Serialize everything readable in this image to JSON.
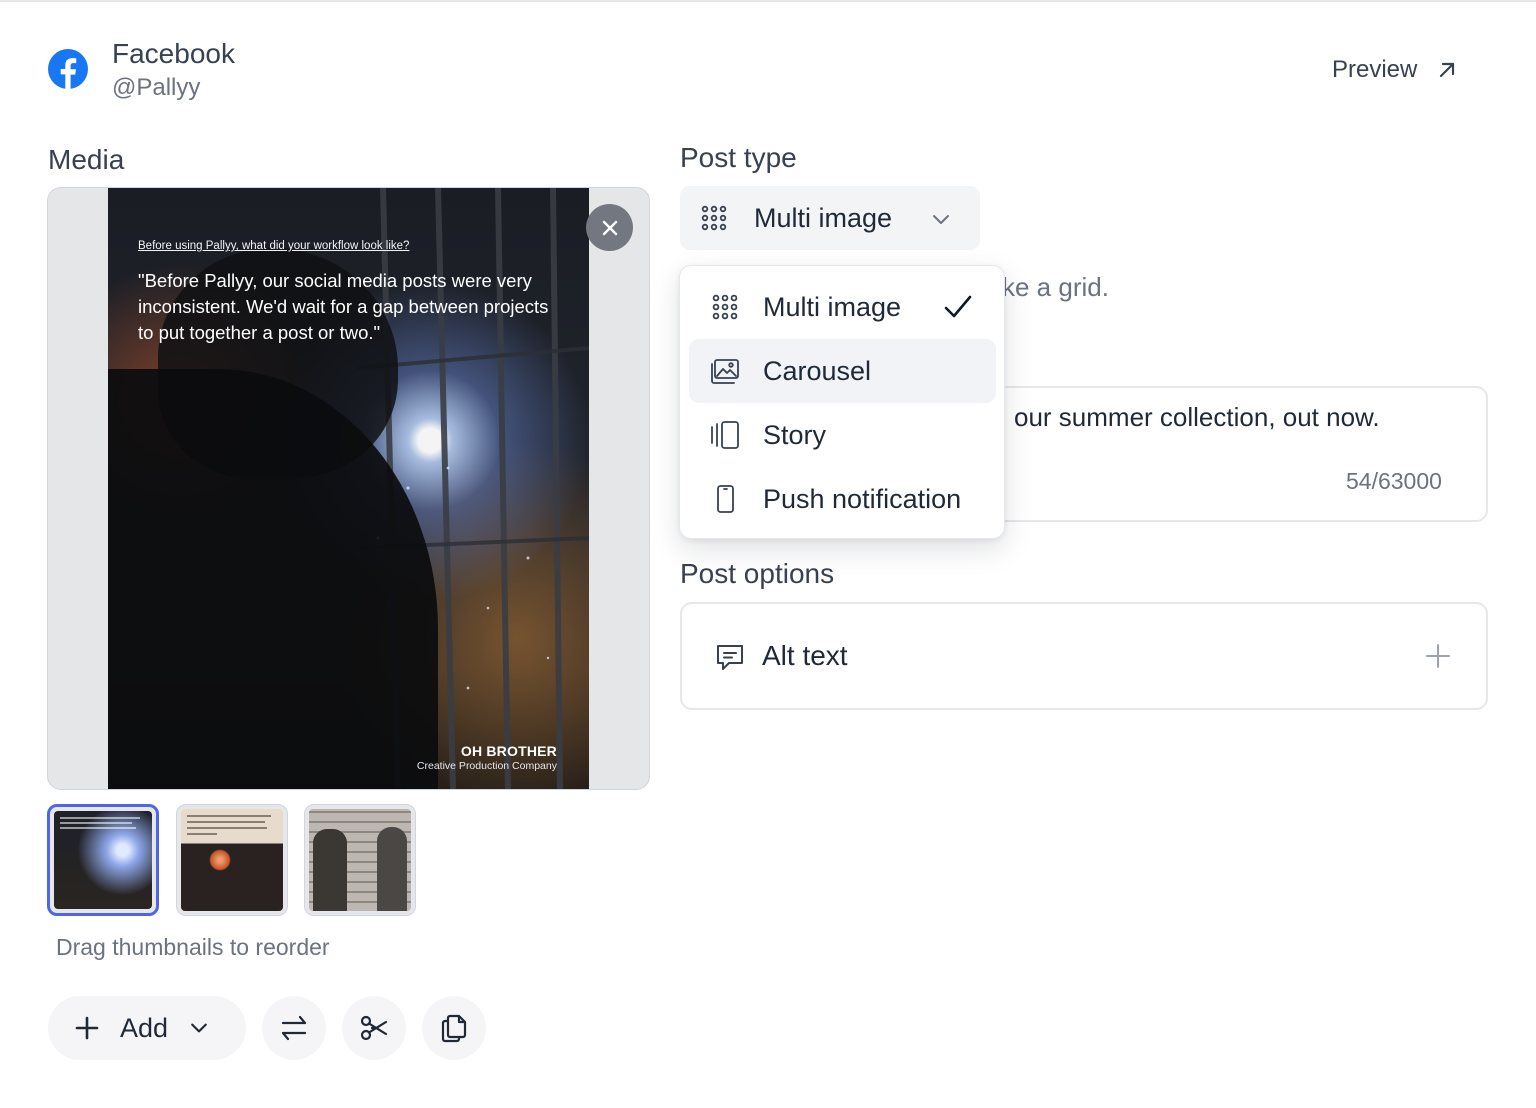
{
  "account": {
    "network": "Facebook",
    "handle": "@Pallyy",
    "brand_color": "#1877f2",
    "icon": "facebook-logo-icon"
  },
  "header": {
    "preview_label": "Preview",
    "preview_icon": "arrow-up-right-icon"
  },
  "media": {
    "label": "Media",
    "main_image": {
      "question": "Before using Pallyy, what did your workflow look like?",
      "quote": "\"Before Pallyy, our social media posts were very inconsistent. We'd wait for a gap between projects to put together a post or two.\"",
      "brand_name": "OH BROTHER",
      "brand_tagline": "Creative Production Company"
    },
    "thumbnails": [
      {
        "name": "thumbnail-1",
        "selected": true
      },
      {
        "name": "thumbnail-2",
        "selected": false
      },
      {
        "name": "thumbnail-3",
        "selected": false
      }
    ],
    "drag_hint": "Drag thumbnails to reorder",
    "selection_color": "#4f67e6"
  },
  "toolbar": {
    "add_label": "Add",
    "buttons": [
      "swap-icon",
      "scissors-icon",
      "copy-icon"
    ]
  },
  "post_type": {
    "label": "Post type",
    "selected": "Multi image",
    "hint_visible": "ke a grid.",
    "options": [
      {
        "label": "Multi image",
        "icon": "grid-icon",
        "checked": true
      },
      {
        "label": "Carousel",
        "icon": "images-icon",
        "checked": false,
        "hovered": true
      },
      {
        "label": "Story",
        "icon": "story-icon",
        "checked": false
      },
      {
        "label": "Push notification",
        "icon": "phone-icon",
        "checked": false
      }
    ]
  },
  "caption": {
    "visible_text": "our summer collection, out now.",
    "char_count": "54/63000"
  },
  "post_options": {
    "label": "Post options",
    "items": [
      {
        "label": "Alt text",
        "icon": "message-icon",
        "action_icon": "plus-icon"
      }
    ]
  }
}
